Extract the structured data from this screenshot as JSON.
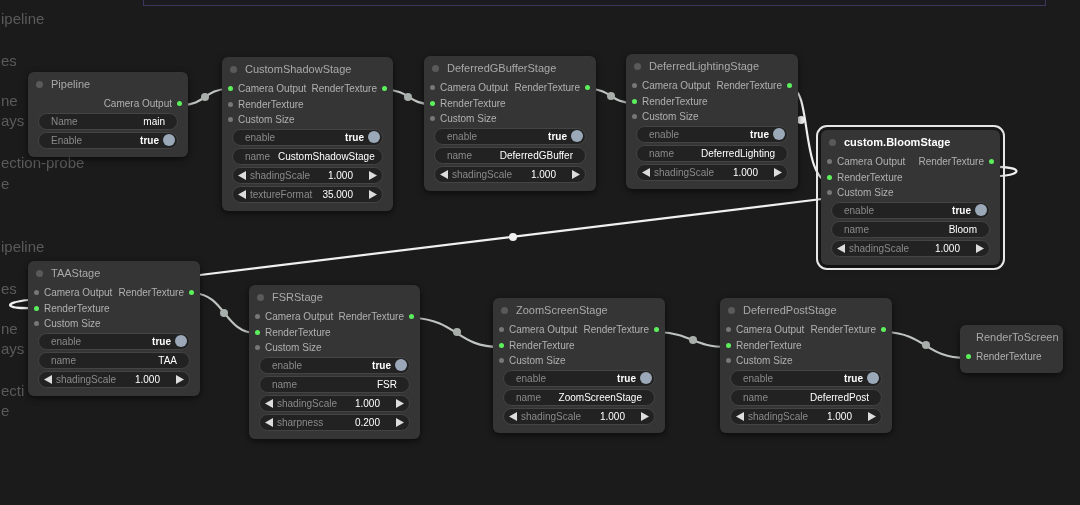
{
  "background_text": [
    "ipeline",
    "es",
    "ne",
    "ays",
    "ection-probe",
    "e",
    "ipeline",
    "es",
    "ne",
    "ays",
    "ecti",
    "e"
  ],
  "nodes": [
    {
      "title": "Pipeline",
      "selected": false,
      "outputs": [
        {
          "label": "Camera Output",
          "connected": true
        }
      ],
      "widgets": [
        {
          "kind": "text",
          "label": "Name",
          "value": "main"
        },
        {
          "kind": "toggle",
          "label": "Enable",
          "value": "true",
          "on": true
        }
      ]
    },
    {
      "title": "CustomShadowStage",
      "selected": false,
      "inputs": [
        {
          "label": "Camera Output",
          "connected": true
        },
        {
          "label": "RenderTexture",
          "connected": false
        },
        {
          "label": "Custom Size",
          "connected": false
        }
      ],
      "outputs": [
        {
          "label": "RenderTexture",
          "connected": true
        }
      ],
      "widgets": [
        {
          "kind": "toggle",
          "label": "enable",
          "value": "true",
          "on": true
        },
        {
          "kind": "text",
          "label": "name",
          "value": "CustomShadowStage"
        },
        {
          "kind": "number",
          "label": "shadingScale",
          "value": "1.000"
        },
        {
          "kind": "number",
          "label": "textureFormat",
          "value": "35.000"
        }
      ]
    },
    {
      "title": "DeferredGBufferStage",
      "selected": false,
      "inputs": [
        {
          "label": "Camera Output",
          "connected": false
        },
        {
          "label": "RenderTexture",
          "connected": true
        },
        {
          "label": "Custom Size",
          "connected": false
        }
      ],
      "outputs": [
        {
          "label": "RenderTexture",
          "connected": true
        }
      ],
      "widgets": [
        {
          "kind": "toggle",
          "label": "enable",
          "value": "true",
          "on": true
        },
        {
          "kind": "text",
          "label": "name",
          "value": "DeferredGBuffer"
        },
        {
          "kind": "number",
          "label": "shadingScale",
          "value": "1.000"
        }
      ]
    },
    {
      "title": "DeferredLightingStage",
      "selected": false,
      "inputs": [
        {
          "label": "Camera Output",
          "connected": false
        },
        {
          "label": "RenderTexture",
          "connected": true
        },
        {
          "label": "Custom Size",
          "connected": false
        }
      ],
      "outputs": [
        {
          "label": "RenderTexture",
          "connected": true
        }
      ],
      "widgets": [
        {
          "kind": "toggle",
          "label": "enable",
          "value": "true",
          "on": true
        },
        {
          "kind": "text",
          "label": "name",
          "value": "DeferredLighting"
        },
        {
          "kind": "number",
          "label": "shadingScale",
          "value": "1.000"
        }
      ]
    },
    {
      "title": "custom.BloomStage",
      "selected": true,
      "inputs": [
        {
          "label": "Camera Output",
          "connected": false
        },
        {
          "label": "RenderTexture",
          "connected": true
        },
        {
          "label": "Custom Size",
          "connected": false
        }
      ],
      "outputs": [
        {
          "label": "RenderTexture",
          "connected": true
        }
      ],
      "widgets": [
        {
          "kind": "toggle",
          "label": "enable",
          "value": "true",
          "on": true
        },
        {
          "kind": "text",
          "label": "name",
          "value": "Bloom"
        },
        {
          "kind": "number",
          "label": "shadingScale",
          "value": "1.000"
        }
      ]
    },
    {
      "title": "TAAStage",
      "selected": false,
      "inputs": [
        {
          "label": "Camera Output",
          "connected": false
        },
        {
          "label": "RenderTexture",
          "connected": true
        },
        {
          "label": "Custom Size",
          "connected": false
        }
      ],
      "outputs": [
        {
          "label": "RenderTexture",
          "connected": true
        }
      ],
      "widgets": [
        {
          "kind": "toggle",
          "label": "enable",
          "value": "true",
          "on": true
        },
        {
          "kind": "text",
          "label": "name",
          "value": "TAA"
        },
        {
          "kind": "number",
          "label": "shadingScale",
          "value": "1.000"
        }
      ]
    },
    {
      "title": "FSRStage",
      "selected": false,
      "inputs": [
        {
          "label": "Camera Output",
          "connected": false
        },
        {
          "label": "RenderTexture",
          "connected": true
        },
        {
          "label": "Custom Size",
          "connected": false
        }
      ],
      "outputs": [
        {
          "label": "RenderTexture",
          "connected": true
        }
      ],
      "widgets": [
        {
          "kind": "toggle",
          "label": "enable",
          "value": "true",
          "on": true
        },
        {
          "kind": "text",
          "label": "name",
          "value": "FSR"
        },
        {
          "kind": "number",
          "label": "shadingScale",
          "value": "1.000"
        },
        {
          "kind": "number",
          "label": "sharpness",
          "value": "0.200"
        }
      ]
    },
    {
      "title": "ZoomScreenStage",
      "selected": false,
      "inputs": [
        {
          "label": "Camera Output",
          "connected": false
        },
        {
          "label": "RenderTexture",
          "connected": true
        },
        {
          "label": "Custom Size",
          "connected": false
        }
      ],
      "outputs": [
        {
          "label": "RenderTexture",
          "connected": true
        }
      ],
      "widgets": [
        {
          "kind": "toggle",
          "label": "enable",
          "value": "true",
          "on": true
        },
        {
          "kind": "text",
          "label": "name",
          "value": "ZoomScreenStage"
        },
        {
          "kind": "number",
          "label": "shadingScale",
          "value": "1.000"
        }
      ]
    },
    {
      "title": "DeferredPostStage",
      "selected": false,
      "inputs": [
        {
          "label": "Camera Output",
          "connected": false
        },
        {
          "label": "RenderTexture",
          "connected": true
        },
        {
          "label": "Custom Size",
          "connected": false
        }
      ],
      "outputs": [
        {
          "label": "RenderTexture",
          "connected": true
        }
      ],
      "widgets": [
        {
          "kind": "toggle",
          "label": "enable",
          "value": "true",
          "on": true
        },
        {
          "kind": "text",
          "label": "name",
          "value": "DeferredPost"
        },
        {
          "kind": "number",
          "label": "shadingScale",
          "value": "1.000"
        }
      ]
    },
    {
      "title": "RenderToScreen",
      "selected": false,
      "inputs": [
        {
          "label": "RenderTexture",
          "connected": true
        }
      ]
    }
  ]
}
